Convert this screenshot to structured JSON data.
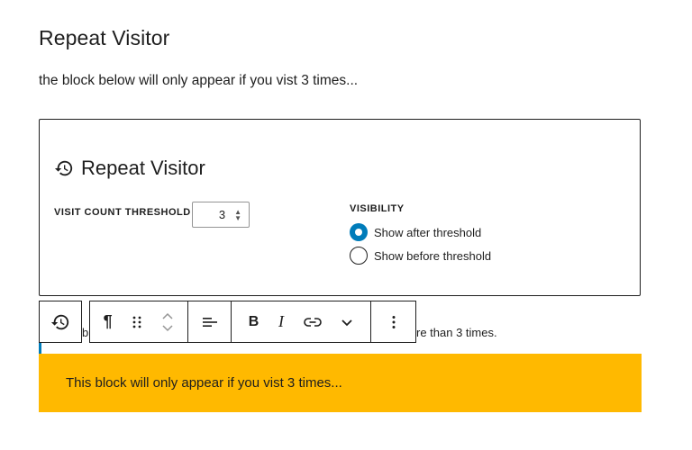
{
  "page": {
    "title": "Repeat Visitor",
    "intro": "the block below will only appear if you vist 3 times..."
  },
  "panel": {
    "heading": "Repeat Visitor",
    "heading_icon": "history-icon",
    "threshold_label": "VISIT COUNT THRESHOLD",
    "threshold_value": "3",
    "visibility_label": "VISIBILITY",
    "options": [
      {
        "label": "Show after threshold",
        "selected": true
      },
      {
        "label": "Show before threshold",
        "selected": false
      }
    ]
  },
  "behind_text": {
    "left": "bl",
    "right": "re than 3 times."
  },
  "toolbar": {
    "paragraph": "¶",
    "bold": "B",
    "italic": "I"
  },
  "yellow_block": {
    "text": "This block will only appear if you vist 3 times..."
  },
  "colors": {
    "accent": "#007cba",
    "highlight": "#ffb900"
  }
}
